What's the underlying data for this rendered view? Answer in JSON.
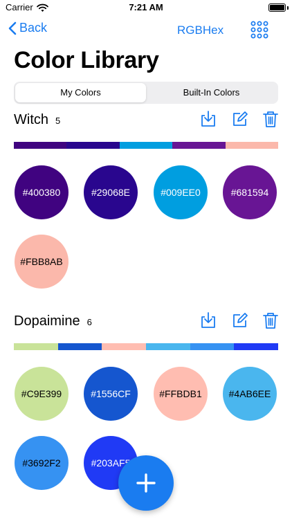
{
  "status": {
    "carrier": "Carrier",
    "time": "7:21 AM"
  },
  "nav": {
    "back_label": "Back",
    "center_label": "RGBHex"
  },
  "page_title": "Color Library",
  "segments": [
    "My Colors",
    "Built-In Colors"
  ],
  "colors": {
    "accent": "#1A7CF0"
  },
  "sections": [
    {
      "name": "Witch",
      "count": "5",
      "colors": [
        {
          "hex": "#400380",
          "label": "#400380",
          "text_color": "#ffffff"
        },
        {
          "hex": "#29068E",
          "label": "#29068E",
          "text_color": "#ffffff"
        },
        {
          "hex": "#009EE0",
          "label": "#009EE0",
          "text_color": "#ffffff"
        },
        {
          "hex": "#681594",
          "label": "#681594",
          "text_color": "#ffffff"
        },
        {
          "hex": "#FBB8AB",
          "label": "#FBB8AB",
          "text_color": "#000000"
        }
      ]
    },
    {
      "name": "Dopaimine",
      "count": "6",
      "colors": [
        {
          "hex": "#C9E399",
          "label": "#C9E399",
          "text_color": "#000000"
        },
        {
          "hex": "#1556CF",
          "label": "#1556CF",
          "text_color": "#ffffff"
        },
        {
          "hex": "#FFBDB1",
          "label": "#FFBDB1",
          "text_color": "#000000"
        },
        {
          "hex": "#4AB6EE",
          "label": "#4AB6EE",
          "text_color": "#000000"
        },
        {
          "hex": "#3692F2",
          "label": "#3692F2",
          "text_color": "#000000"
        },
        {
          "hex": "#203AF5",
          "label": "#203AF5",
          "text_color": "#ffffff"
        }
      ]
    }
  ]
}
